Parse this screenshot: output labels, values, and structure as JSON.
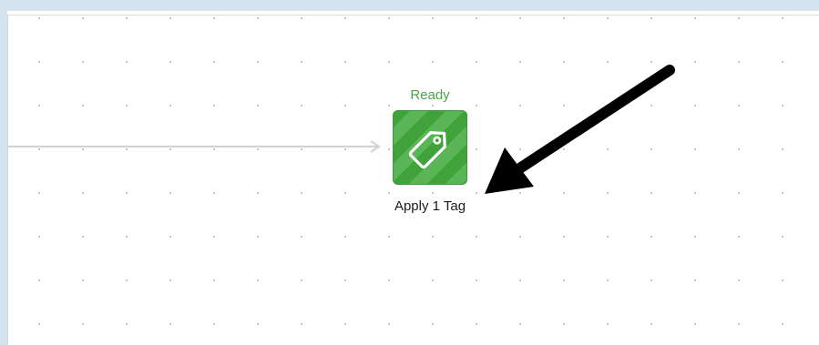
{
  "workflow": {
    "node": {
      "status": "Ready",
      "label": "Apply 1 Tag",
      "icon": "tag-icon"
    }
  },
  "colors": {
    "status": "#4aa446",
    "tile_primary": "#3fa23b",
    "tile_stripe": "#5ab556",
    "connector": "#cccccc",
    "annotation_arrow": "#000000"
  }
}
